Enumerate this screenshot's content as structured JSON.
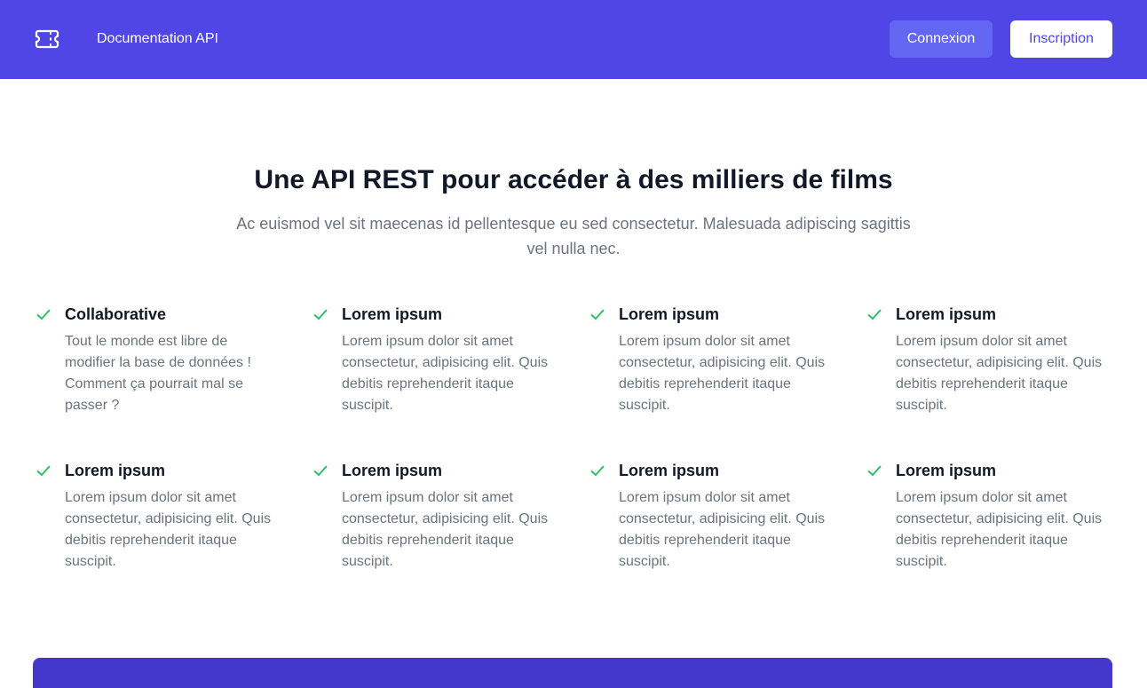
{
  "header": {
    "logo_icon": "ticket-icon",
    "nav_link": "Documentation API",
    "login_label": "Connexion",
    "signup_label": "Inscription",
    "brand_color": "#4f46e5"
  },
  "hero": {
    "title": "Une API REST pour accéder à des milliers de films",
    "subtitle": "Ac euismod vel sit maecenas id pellentesque eu sed consectetur. Malesuada adipiscing sagittis vel nulla nec."
  },
  "features": [
    {
      "icon": "check-icon",
      "title": "Collaborative",
      "description": "Tout le monde est libre de modifier la base de données ! Comment ça pourrait mal se passer ?"
    },
    {
      "icon": "check-icon",
      "title": "Lorem ipsum",
      "description": "Lorem ipsum dolor sit amet consectetur, adipisicing elit. Quis debitis reprehenderit itaque suscipit."
    },
    {
      "icon": "check-icon",
      "title": "Lorem ipsum",
      "description": "Lorem ipsum dolor sit amet consectetur, adipisicing elit. Quis debitis reprehenderit itaque suscipit."
    },
    {
      "icon": "check-icon",
      "title": "Lorem ipsum",
      "description": "Lorem ipsum dolor sit amet consectetur, adipisicing elit. Quis debitis reprehenderit itaque suscipit."
    },
    {
      "icon": "check-icon",
      "title": "Lorem ipsum",
      "description": "Lorem ipsum dolor sit amet consectetur, adipisicing elit. Quis debitis reprehenderit itaque suscipit."
    },
    {
      "icon": "check-icon",
      "title": "Lorem ipsum",
      "description": "Lorem ipsum dolor sit amet consectetur, adipisicing elit. Quis debitis reprehenderit itaque suscipit."
    },
    {
      "icon": "check-icon",
      "title": "Lorem ipsum",
      "description": "Lorem ipsum dolor sit amet consectetur, adipisicing elit. Quis debitis reprehenderit itaque suscipit."
    },
    {
      "icon": "check-icon",
      "title": "Lorem ipsum",
      "description": "Lorem ipsum dolor sit amet consectetur, adipisicing elit. Quis debitis reprehenderit itaque suscipit."
    }
  ],
  "colors": {
    "accent": "#4f46e5",
    "check": "#22c55e",
    "cta_band": "#4338ca"
  }
}
